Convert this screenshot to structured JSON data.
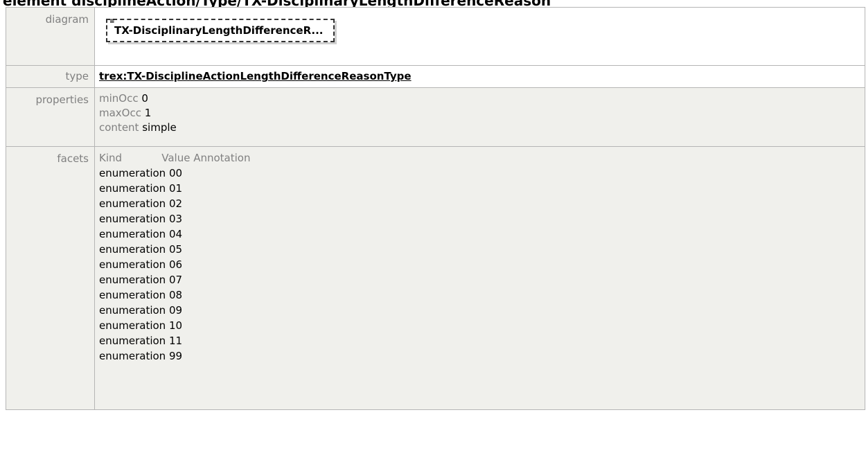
{
  "heading": "element disciplineAction/Type/TX-DisciplinaryLengthDifferenceReason",
  "rows": {
    "diagram": {
      "label": "diagram",
      "box_text": "TX-DisciplinaryLengthDifferenceR...",
      "icon": "lines-icon"
    },
    "type": {
      "label": "type",
      "link": "trex:TX-DisciplineActionLengthDifferenceReasonType"
    },
    "properties": {
      "label": "properties",
      "items": [
        {
          "key": "minOcc",
          "value": "0"
        },
        {
          "key": "maxOcc",
          "value": "1"
        },
        {
          "key": "content",
          "value": "simple"
        }
      ]
    },
    "facets": {
      "label": "facets",
      "header": "Kind            Value Annotation",
      "items": [
        "enumeration 00",
        "enumeration 01",
        "enumeration 02",
        "enumeration 03",
        "enumeration 04",
        "enumeration 05",
        "enumeration 06",
        "enumeration 07",
        "enumeration 08",
        "enumeration 09",
        "enumeration 10",
        "enumeration 11",
        "enumeration 99"
      ]
    }
  }
}
